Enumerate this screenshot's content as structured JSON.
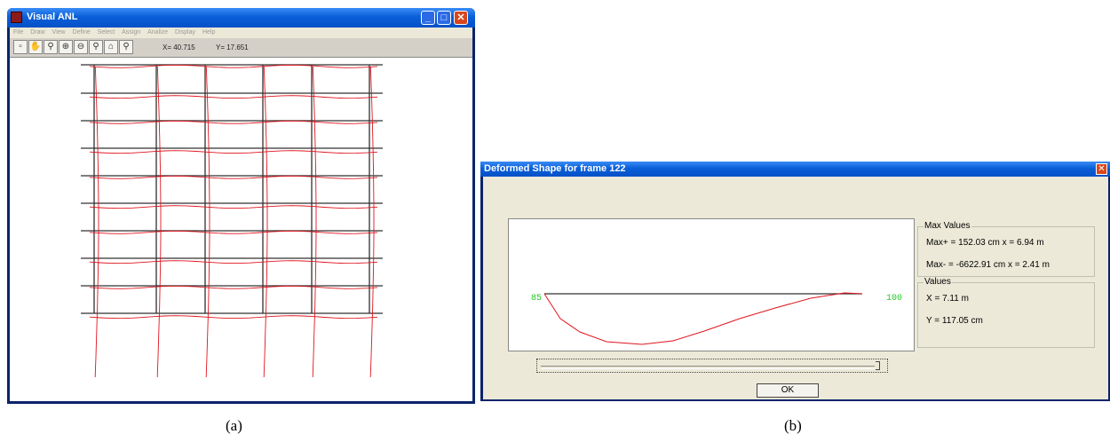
{
  "window_a": {
    "title": "Visual ANL",
    "menu": [
      "File",
      "Draw",
      "View",
      "Define",
      "Select",
      "Assign",
      "Analize",
      "Display",
      "Help"
    ],
    "toolbar_icons": [
      "new-icon",
      "pan-hand-icon",
      "zoom-icon",
      "zoom-in-icon",
      "zoom-out-icon",
      "zoom-extents-icon",
      "print-icon",
      "zoom-window-icon"
    ],
    "coord_x": "X= 40.715",
    "coord_y": "Y= 17.651",
    "title_buttons": [
      "minimize-icon",
      "maximize-icon",
      "close-icon"
    ]
  },
  "window_b": {
    "title": "Deformed Shape for frame 122",
    "left_label": "85",
    "right_label": "100",
    "max_group": {
      "legend": "Max Values",
      "max_plus": "Max+ = 152.03 cm x = 6.94 m",
      "max_minus": "Max- = -6622.91 cm x = 2.41 m"
    },
    "values_group": {
      "legend": "Values",
      "x": "X = 7.11 m",
      "y": "Y = 117.05 cm"
    },
    "ok_label": "OK"
  },
  "captions": {
    "a": "(a)",
    "b": "(b)"
  },
  "colors": {
    "deformed": "#e0141e",
    "undeformed": "#303030",
    "label_green": "#22cc22",
    "titlebar": "#0a5fd8"
  }
}
